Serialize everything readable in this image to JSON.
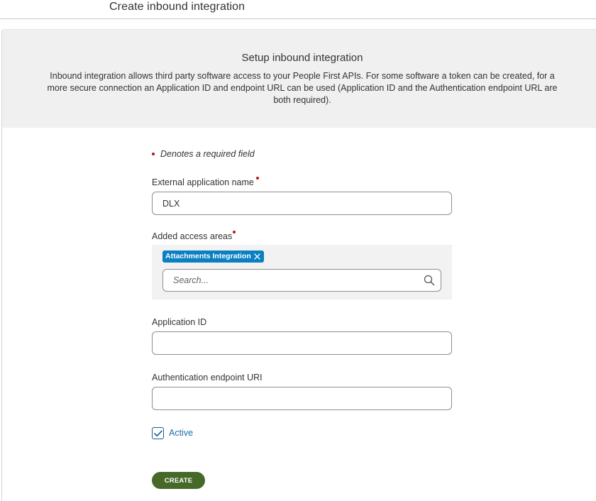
{
  "header": {
    "title": "Create inbound integration"
  },
  "intro": {
    "heading": "Setup inbound integration",
    "description": "Inbound integration allows third party software access to your People First APIs. For some software a token can be created, for a more secure connection an Application ID and endpoint URL can be used (Application ID and the Authentication endpoint URL are both required)."
  },
  "form": {
    "required_note": "Denotes a required field",
    "app_name": {
      "label": "External application name",
      "value": "DLX"
    },
    "access_areas": {
      "label": "Added access areas",
      "chips": [
        "Attachments Integration"
      ],
      "search_placeholder": "Search..."
    },
    "application_id": {
      "label": "Application ID",
      "value": ""
    },
    "auth_endpoint": {
      "label": "Authentication endpoint URI",
      "value": ""
    },
    "active": {
      "label": "Active",
      "checked": true
    },
    "create_label": "CREATE"
  },
  "colors": {
    "required": "#b0181f",
    "chip": "#0a7fc2",
    "primary_button": "#46692a",
    "header_band": "#f0f0f0",
    "link_text": "#1a6fa8"
  },
  "icons": {
    "search": "search-icon",
    "chip_remove": "close-icon",
    "checkbox": "checkmark-icon"
  }
}
